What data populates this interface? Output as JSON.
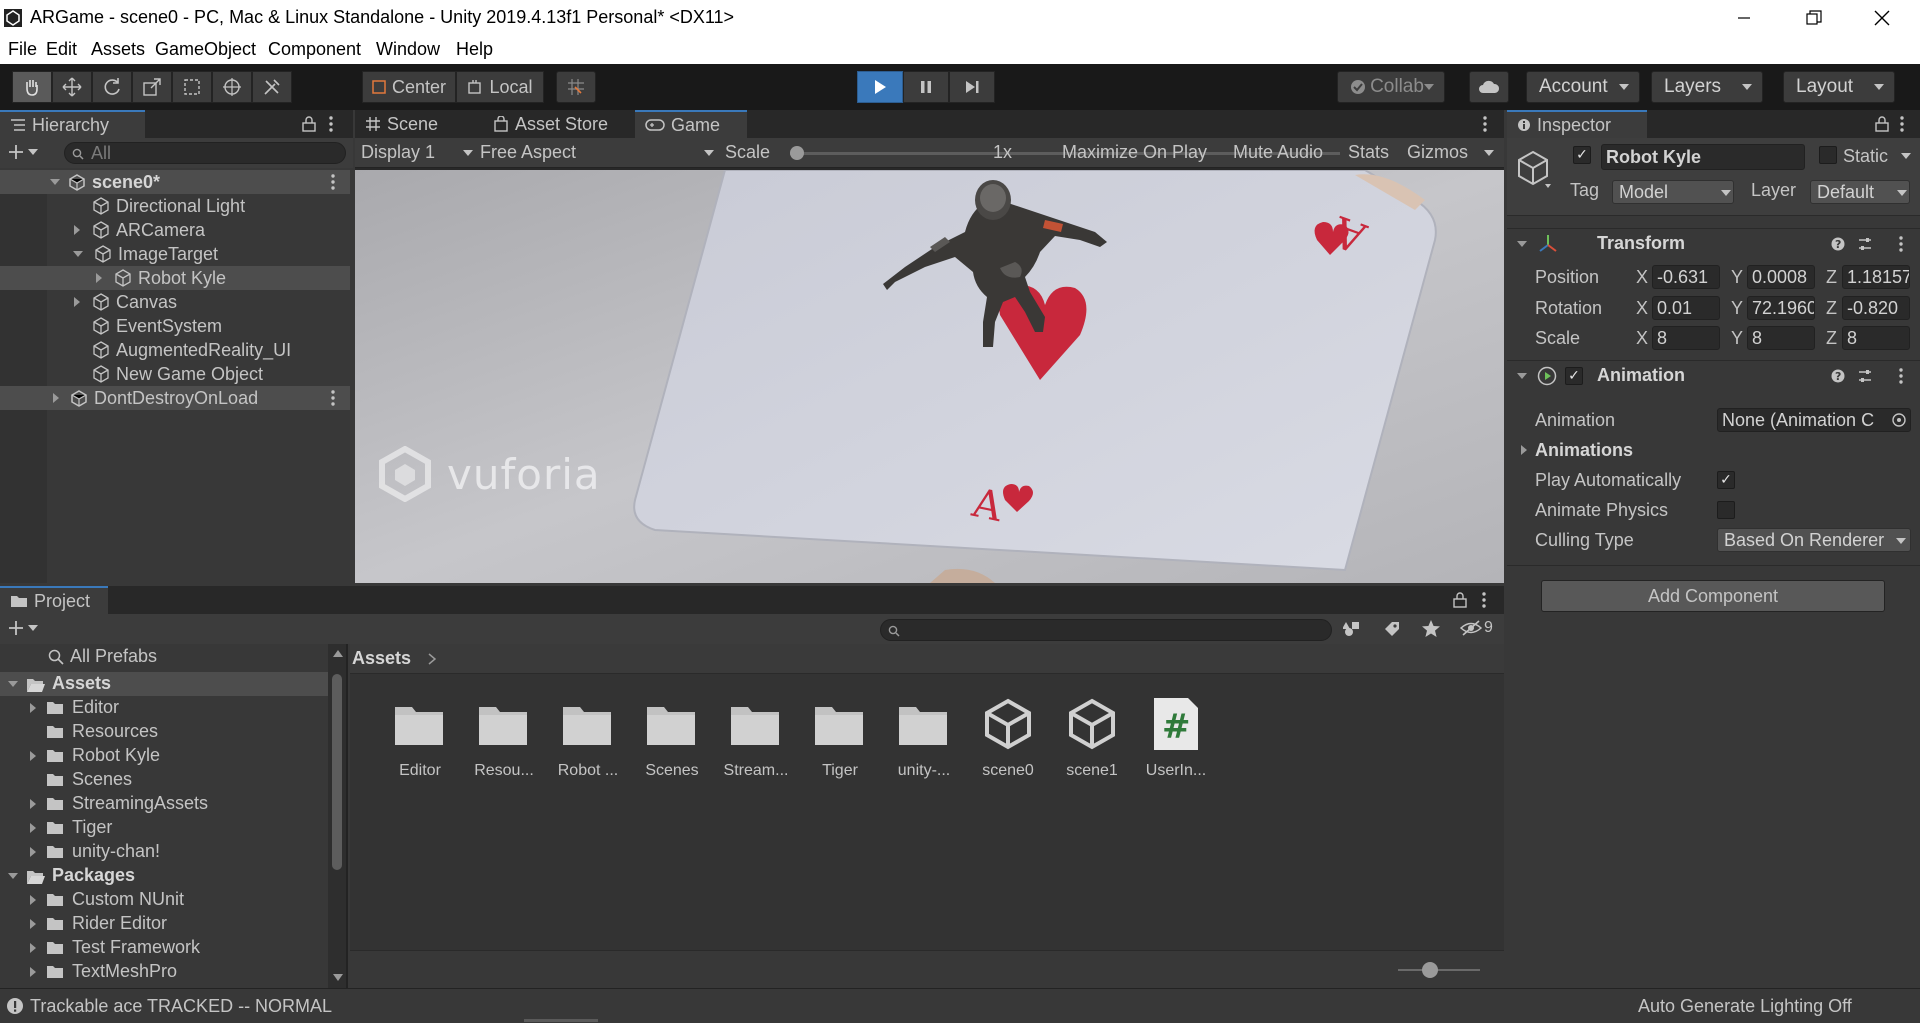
{
  "window": {
    "title": "ARGame - scene0 - PC, Mac & Linux Standalone - Unity 2019.4.13f1 Personal* <DX11>"
  },
  "menu": [
    "File",
    "Edit",
    "Assets",
    "GameObject",
    "Component",
    "Window",
    "Help"
  ],
  "toolbar": {
    "pivot_label": "Center",
    "space_label": "Local",
    "collab_label": "Collab",
    "account_label": "Account",
    "layers_label": "Layers",
    "layout_label": "Layout"
  },
  "hierarchy": {
    "tab_label": "Hierarchy",
    "search_placeholder": "All",
    "scene_name": "scene0*",
    "items": [
      {
        "label": "Directional Light"
      },
      {
        "label": "ARCamera"
      },
      {
        "label": "ImageTarget"
      },
      {
        "label": "Robot Kyle"
      },
      {
        "label": "Canvas"
      },
      {
        "label": "EventSystem"
      },
      {
        "label": "AugmentedReality_UI"
      },
      {
        "label": "New Game Object"
      }
    ],
    "dont_destroy": "DontDestroyOnLoad"
  },
  "center_tabs": [
    "Scene",
    "Asset Store",
    "Game"
  ],
  "game_toolbar": {
    "display": "Display 1",
    "aspect": "Free Aspect",
    "scale_label": "Scale",
    "scale_value": "1x",
    "scale_level": 0,
    "maximize": "Maximize On Play",
    "mute": "Mute Audio",
    "stats": "Stats",
    "gizmos": "Gizmos"
  },
  "game_view": {
    "watermark": "vuforia",
    "card_rank": "A"
  },
  "inspector": {
    "tab_label": "Inspector",
    "object_name": "Robot Kyle",
    "static_label": "Static",
    "tag_label": "Tag",
    "tag_value": "Model",
    "layer_label": "Layer",
    "layer_value": "Default",
    "transform": {
      "title": "Transform",
      "position_label": "Position",
      "rotation_label": "Rotation",
      "scale_label": "Scale",
      "position": {
        "x": "-0.631",
        "y": "0.0008",
        "z": "1.18157"
      },
      "rotation": {
        "x": "0.01",
        "y": "72.1960",
        "z": "-0.820"
      },
      "scale": {
        "x": "8",
        "y": "8",
        "z": "8"
      },
      "axis_x": "X",
      "axis_y": "Y",
      "axis_z": "Z"
    },
    "animation": {
      "title": "Animation",
      "animation_label": "Animation",
      "animation_value": "None (Animation C",
      "animations_label": "Animations",
      "play_auto_label": "Play Automatically",
      "animate_physics_label": "Animate Physics",
      "culling_label": "Culling Type",
      "culling_value": "Based On Renderer"
    },
    "add_component": "Add Component"
  },
  "project": {
    "tab_label": "Project",
    "all_prefabs": "All Prefabs",
    "hidden_count": "9",
    "breadcrumb": "Assets",
    "tree": [
      {
        "label": "Assets",
        "bold": true
      },
      {
        "label": "Editor"
      },
      {
        "label": "Resources"
      },
      {
        "label": "Robot Kyle"
      },
      {
        "label": "Scenes"
      },
      {
        "label": "StreamingAssets"
      },
      {
        "label": "Tiger"
      },
      {
        "label": "unity-chan!"
      },
      {
        "label": "Packages",
        "bold": true
      },
      {
        "label": "Custom NUnit"
      },
      {
        "label": "Rider Editor"
      },
      {
        "label": "Test Framework"
      },
      {
        "label": "TextMeshPro"
      }
    ],
    "assets": [
      {
        "label": "Editor",
        "type": "folder"
      },
      {
        "label": "Resou...",
        "type": "folder"
      },
      {
        "label": "Robot ...",
        "type": "folder"
      },
      {
        "label": "Scenes",
        "type": "folder"
      },
      {
        "label": "Stream...",
        "type": "folder"
      },
      {
        "label": "Tiger",
        "type": "folder"
      },
      {
        "label": "unity-...",
        "type": "folder"
      },
      {
        "label": "scene0",
        "type": "scene"
      },
      {
        "label": "scene1",
        "type": "scene"
      },
      {
        "label": "UserIn...",
        "type": "script"
      }
    ]
  },
  "statusbar": {
    "message": "Trackable ace TRACKED -- NORMAL",
    "lighting": "Auto Generate Lighting Off"
  },
  "colors": {
    "accent": "#3a79bb",
    "play_active": "#3a79bb",
    "panel": "#383838",
    "toolbar": "#191919"
  }
}
